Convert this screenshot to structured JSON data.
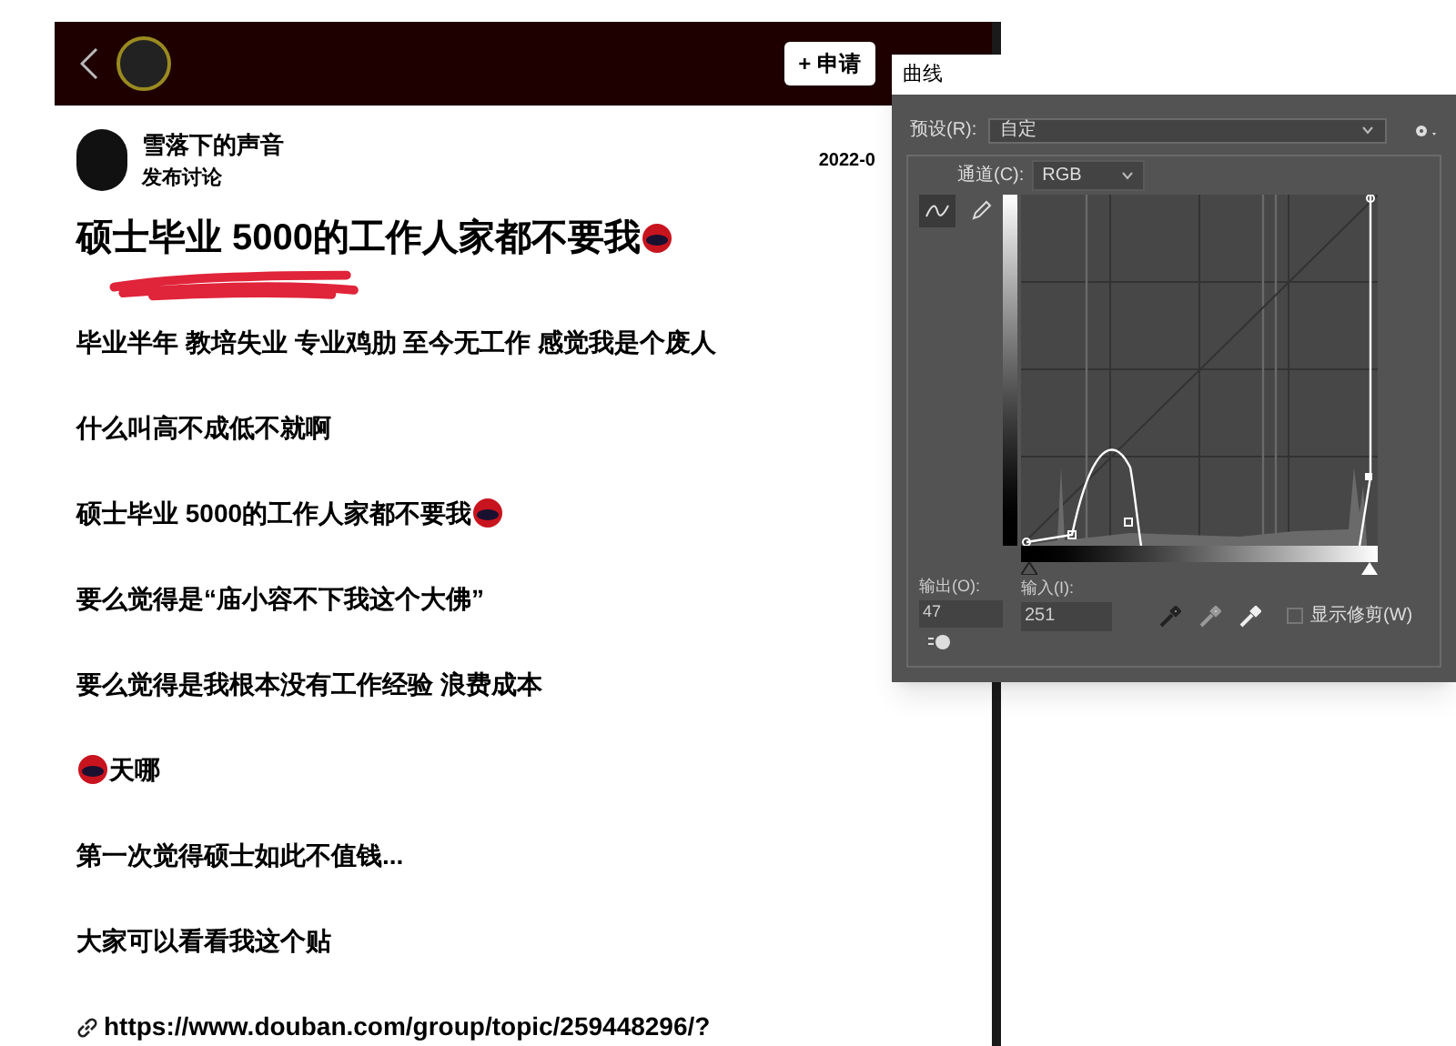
{
  "document": {
    "header": {
      "button": "+ 申请"
    },
    "post": {
      "author": "雪落下的声音",
      "action": "发布讨论",
      "date": "2022-0",
      "title": "硕士毕业 5000的工作人家都不要我",
      "title_emoji_after": true,
      "paragraphs": [
        {
          "kind": "text",
          "text": "毕业半年 教培失业 专业鸡肋 至今无工作 感觉我是个废人"
        },
        {
          "kind": "text",
          "text": "什么叫高不成低不就啊"
        },
        {
          "kind": "text",
          "text": "硕士毕业 5000的工作人家都不要我",
          "emoji_after": true
        },
        {
          "kind": "text",
          "text": "要么觉得是“庙小容不下我这个大佛”"
        },
        {
          "kind": "text",
          "text": "要么觉得是我根本没有工作经验 浪费成本"
        },
        {
          "kind": "text",
          "text": "天哪",
          "emoji_before": true
        },
        {
          "kind": "text",
          "text": "第一次觉得硕士如此不值钱..."
        },
        {
          "kind": "text",
          "text": "大家可以看看我这个贴"
        },
        {
          "kind": "link",
          "text": "https://www.douban.com/group/topic/259448296/?"
        }
      ]
    }
  },
  "dialog": {
    "title": "曲线",
    "preset_label": "预设(R):",
    "preset_value": "自定",
    "channel_label": "通道(C):",
    "channel_value": "RGB",
    "tools": [
      {
        "kind": "curve",
        "selected": true
      },
      {
        "kind": "pencil",
        "selected": false
      }
    ],
    "output_label": "输出(O):",
    "output_value": "47",
    "input_label": "输入(I):",
    "input_value": "251",
    "show_clipping": {
      "label": "显示修剪(W)",
      "checked": false
    }
  }
}
